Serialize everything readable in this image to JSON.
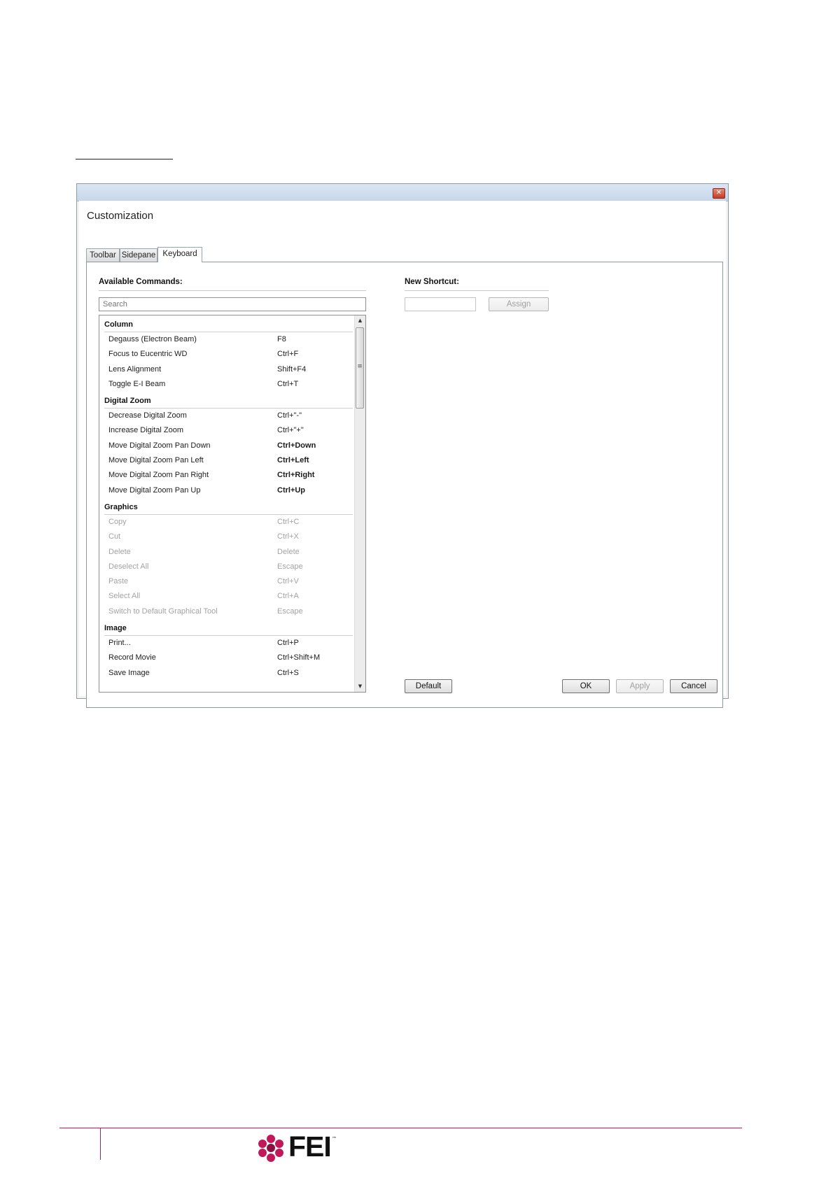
{
  "window": {
    "title": "Customization",
    "close_glyph": "✕"
  },
  "tabs": [
    {
      "label": "Toolbar"
    },
    {
      "label": "Sidepane"
    },
    {
      "label": "Keyboard",
      "active": true
    }
  ],
  "available_commands": {
    "label": "Available Commands:",
    "search_placeholder": "Search",
    "groups": [
      {
        "name": "Column",
        "items": [
          {
            "command": "Degauss (Electron Beam)",
            "shortcut": "F8"
          },
          {
            "command": "Focus to Eucentric WD",
            "shortcut": "Ctrl+F"
          },
          {
            "command": "Lens Alignment",
            "shortcut": "Shift+F4"
          },
          {
            "command": "Toggle E-I Beam",
            "shortcut": "Ctrl+T"
          }
        ]
      },
      {
        "name": "Digital Zoom",
        "items": [
          {
            "command": "Decrease Digital Zoom",
            "shortcut": "Ctrl+\"-\""
          },
          {
            "command": "Increase Digital Zoom",
            "shortcut": "Ctrl+\"+\""
          },
          {
            "command": "Move Digital Zoom Pan Down",
            "shortcut": "Ctrl+Down"
          },
          {
            "command": "Move Digital Zoom Pan Left",
            "shortcut": "Ctrl+Left"
          },
          {
            "command": "Move Digital Zoom Pan Right",
            "shortcut": "Ctrl+Right"
          },
          {
            "command": "Move Digital Zoom Pan Up",
            "shortcut": "Ctrl+Up"
          }
        ]
      },
      {
        "name": "Graphics",
        "items": [
          {
            "command": "Copy",
            "shortcut": "Ctrl+C",
            "disabled": true
          },
          {
            "command": "Cut",
            "shortcut": "Ctrl+X",
            "disabled": true
          },
          {
            "command": "Delete",
            "shortcut": "Delete",
            "disabled": true
          },
          {
            "command": "Deselect All",
            "shortcut": "Escape",
            "disabled": true
          },
          {
            "command": "Paste",
            "shortcut": "Ctrl+V",
            "disabled": true
          },
          {
            "command": "Select All",
            "shortcut": "Ctrl+A",
            "disabled": true
          },
          {
            "command": "Switch to Default Graphical Tool",
            "shortcut": "Escape",
            "disabled": true
          }
        ]
      },
      {
        "name": "Image",
        "items": [
          {
            "command": "Print...",
            "shortcut": "Ctrl+P"
          },
          {
            "command": "Record Movie",
            "shortcut": "Ctrl+Shift+M"
          },
          {
            "command": "Save Image",
            "shortcut": "Ctrl+S"
          }
        ]
      }
    ]
  },
  "new_shortcut": {
    "label": "New Shortcut:",
    "value": "",
    "assign_label": "Assign"
  },
  "buttons": {
    "default_label": "Default",
    "ok_label": "OK",
    "apply_label": "Apply",
    "cancel_label": "Cancel"
  },
  "footer": {
    "logo_text": "FEI",
    "logo_tm": "™",
    "brand_color": "#c2185b"
  }
}
